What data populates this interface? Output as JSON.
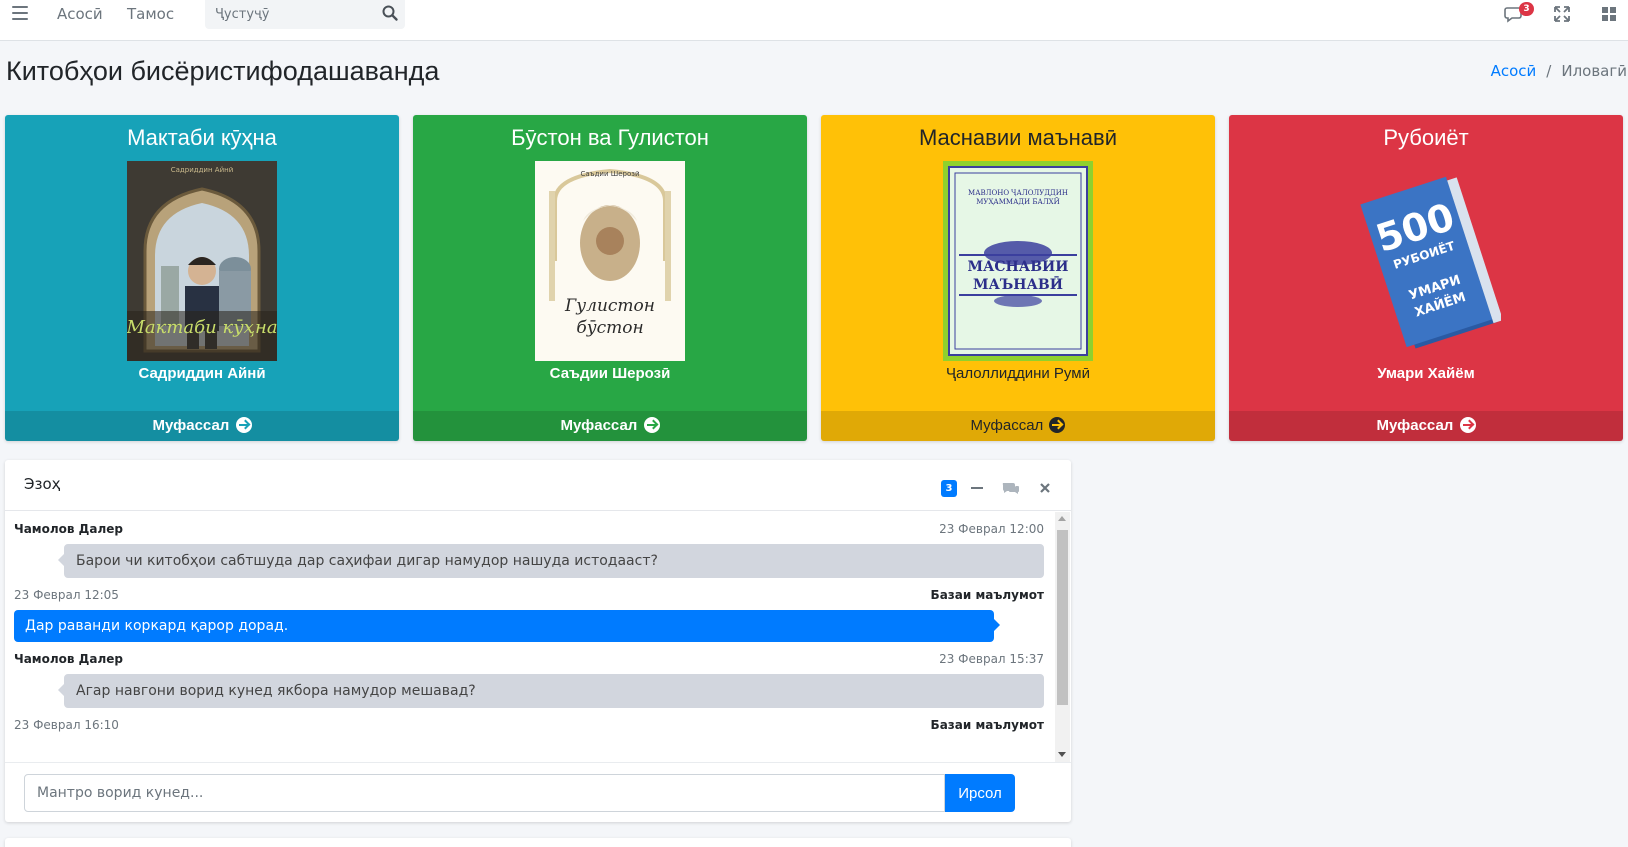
{
  "navbar": {
    "links": [
      "Асосӣ",
      "Тамос"
    ],
    "search_placeholder": "Ҷустуҷӯ",
    "messages_badge": "3"
  },
  "header": {
    "title": "Китобҳои бисёристифодашаванда",
    "breadcrumb": {
      "home": "Асосӣ",
      "separator": "/",
      "active": "Иловагӣ"
    }
  },
  "books": [
    {
      "title": "Мактаби кӯҳна",
      "author": "Садриддин Айнӣ",
      "more": "Муфассал",
      "color": "#17a2b8",
      "cover_caption": "Мактаби кӯҳна"
    },
    {
      "title": "Бӯстон ва Гулистон",
      "author": "Саъдии Шерозӣ",
      "more": "Муфассал",
      "color": "#28a745",
      "cover_caption": "Гулистон бӯстон"
    },
    {
      "title": "Маснавии маънавӣ",
      "author": "Ҷалоллиддини Румӣ",
      "more": "Муфассал",
      "color": "#ffc107",
      "cover_caption": "МАСНАВИИ МАЪНАВӢ"
    },
    {
      "title": "Рубоиёт",
      "author": "Умари Хайём",
      "more": "Муфассал",
      "color": "#dc3545",
      "cover_caption": "500 РУБОИЁТ УМАРИ ХАЙЁМ"
    }
  ],
  "chat": {
    "title": "Эзоҳ",
    "badge": "3",
    "messages": [
      {
        "side": "left",
        "name": "Чамолов Далер",
        "time": "23 Феврал 12:00",
        "text": "Барои чи китобҳои сабтшуда дар саҳифаи дигар намудор нашуда истодааст?"
      },
      {
        "side": "right",
        "name": "Базаи маълумот",
        "time": "23 Феврал 12:05",
        "text": "Дар раванди коркард қарор дорад."
      },
      {
        "side": "left",
        "name": "Чамолов Далер",
        "time": "23 Феврал 15:37",
        "text": "Агар навгони ворид кунед якбора намудор мешавад?"
      },
      {
        "side": "right",
        "name": "Базаи маълумот",
        "time": "23 Феврал 16:10",
        "text": ""
      }
    ],
    "input_placeholder": "Мантро ворид кунед...",
    "send_label": "Ирсол"
  }
}
